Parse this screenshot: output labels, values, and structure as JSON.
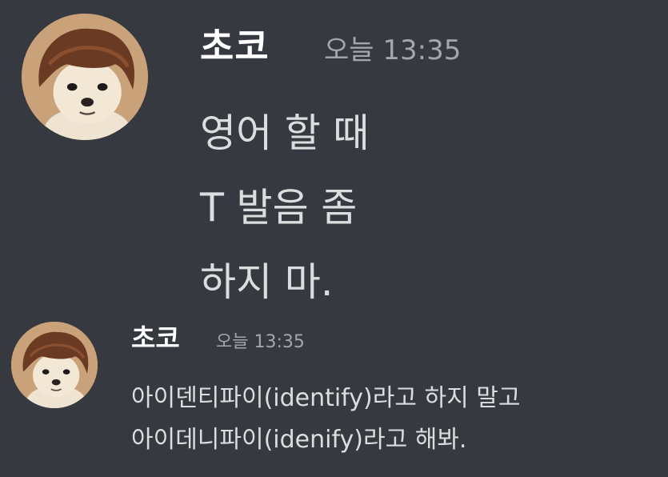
{
  "messages": [
    {
      "username": "초코",
      "timestamp": "오늘 13:35",
      "avatar": "dog-with-wig-avatar",
      "lines": [
        "영어 할 때",
        "T 발음 좀",
        "하지 마."
      ]
    },
    {
      "username": "초코",
      "timestamp": "오늘 13:35",
      "avatar": "dog-with-wig-avatar",
      "lines": [
        "아이덴티파이(identify)라고 하지 말고",
        "아이데니파이(idenify)라고 해봐."
      ]
    }
  ],
  "colors": {
    "background": "#36393f",
    "username": "#ffffff",
    "timestamp": "#a3a6aa",
    "text": "#dcddde"
  }
}
